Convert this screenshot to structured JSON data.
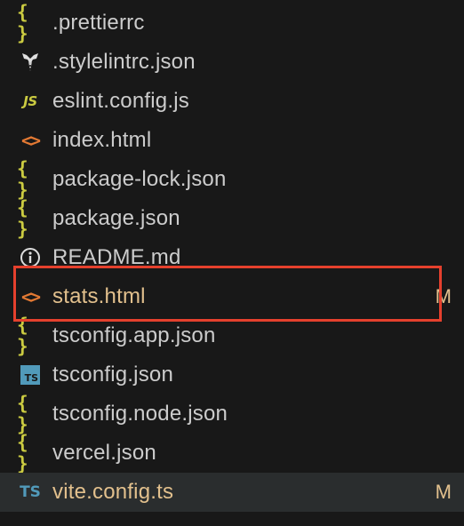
{
  "colors": {
    "background": "#181818",
    "selected_row": "#2a2d2e",
    "default_text": "#cccccc",
    "modified_text": "#e2c08d",
    "highlight_border": "#e5402d",
    "json_icon": "#cbcb41",
    "html_icon": "#e37933",
    "ts_icon": "#519aba",
    "info_icon": "#dddddd"
  },
  "files": [
    {
      "name": ".prettierrc",
      "icon": "json-braces-icon",
      "glyph": "{ }",
      "badge": ""
    },
    {
      "name": ".stylelintrc.json",
      "icon": "stylelint-icon",
      "glyph": "",
      "badge": ""
    },
    {
      "name": "eslint.config.js",
      "icon": "javascript-icon",
      "glyph": "JS",
      "badge": ""
    },
    {
      "name": "index.html",
      "icon": "html-icon",
      "glyph": "<>",
      "badge": ""
    },
    {
      "name": "package-lock.json",
      "icon": "json-braces-icon",
      "glyph": "{ }",
      "badge": ""
    },
    {
      "name": "package.json",
      "icon": "json-braces-icon",
      "glyph": "{ }",
      "badge": ""
    },
    {
      "name": "README.md",
      "icon": "info-icon",
      "glyph": "",
      "badge": ""
    },
    {
      "name": "stats.html",
      "icon": "html-icon",
      "glyph": "<>",
      "badge": "M"
    },
    {
      "name": "tsconfig.app.json",
      "icon": "json-braces-icon",
      "glyph": "{ }",
      "badge": ""
    },
    {
      "name": "tsconfig.json",
      "icon": "typescript-config-icon",
      "glyph": "TS",
      "badge": ""
    },
    {
      "name": "tsconfig.node.json",
      "icon": "json-braces-icon",
      "glyph": "{ }",
      "badge": ""
    },
    {
      "name": "vercel.json",
      "icon": "json-braces-icon",
      "glyph": "{ }",
      "badge": ""
    },
    {
      "name": "vite.config.ts",
      "icon": "typescript-icon",
      "glyph": "TS",
      "badge": "M"
    }
  ]
}
